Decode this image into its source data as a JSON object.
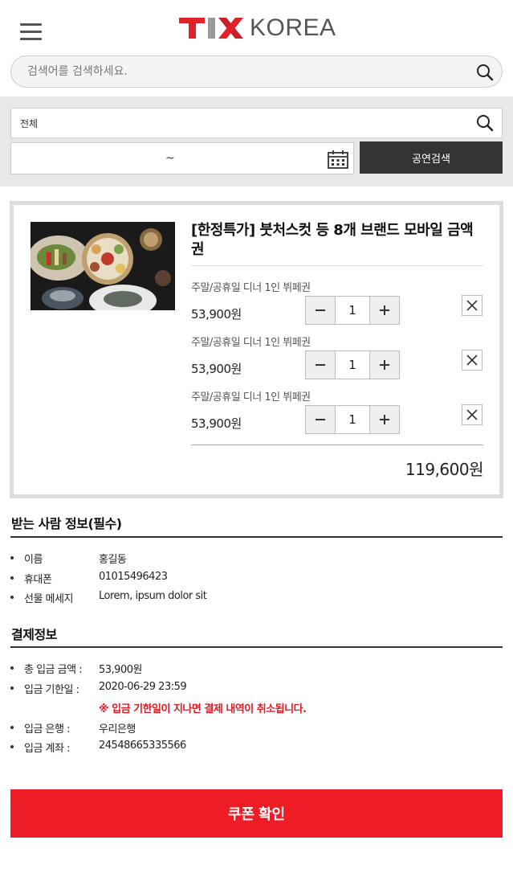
{
  "header": {
    "logo_text": "KOREA",
    "menu_icon": "hamburger-menu-icon",
    "brand_colors": {
      "tix_red": "#e32129",
      "x_red": "#c8202b",
      "gray": "#555555"
    }
  },
  "search": {
    "placeholder": "검색어를 검색하세요.",
    "icon": "search-icon"
  },
  "filter": {
    "genre_value": "전체",
    "date_separator": "~",
    "calendar_icon": "calendar-icon",
    "submit_label": "공연검색"
  },
  "cart": {
    "product_title": "[한정특가] 붓처스컷 등 8개 브랜드 모바일 금액권",
    "options": [
      {
        "name": "주말/공휴일 디너 1인 뷔페권",
        "price": "53,900원",
        "quantity": "1"
      },
      {
        "name": "주말/공휴일 디너 1인 뷔페권",
        "price": "53,900원",
        "quantity": "1"
      },
      {
        "name": "주말/공휴일 디너 1인 뷔페권",
        "price": "53,900원",
        "quantity": "1"
      }
    ],
    "total": "119,600원"
  },
  "recipient": {
    "title": "받는 사람 정보(필수)",
    "rows": [
      {
        "label": "이름",
        "value": "홍길동"
      },
      {
        "label": "휴대폰",
        "value": "01015496423"
      },
      {
        "label": "선물 메세지",
        "value": "Lorem, ipsum dolor sit"
      }
    ]
  },
  "payment": {
    "title": "결제정보",
    "rows": [
      {
        "label": "총 입금 금액 :",
        "value": "53,900원"
      },
      {
        "label": "입금 기한일 :",
        "value": "2020-06-29 23:59"
      },
      {
        "label": "입금 은행 :",
        "value": "우리은행"
      },
      {
        "label": "입금 계좌 :",
        "value": "24548665335566"
      }
    ],
    "notice": "※ 입금 기한일이 지나면 결제 내역이 취소됩니다.",
    "notice_color": "#e01b22"
  },
  "coupon_button": {
    "label": "쿠폰 확인",
    "color": "#ee1c25"
  }
}
